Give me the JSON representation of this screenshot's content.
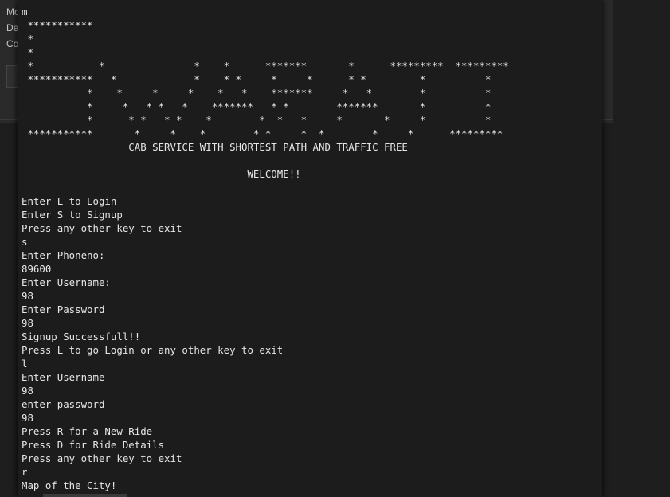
{
  "background_window": {
    "labels": [
      "Mo",
      "De",
      "Co"
    ]
  },
  "terminal": {
    "lines": [
      "m",
      " ***********",
      " *",
      " *",
      " *           *               *    *      *******       *      *********  *********",
      " ***********   *             *    * *     *     *      * *         *          *",
      "           *    *     *     *    *   *    *******     *   *        *          *",
      "           *     *   * *   *    *******   * *        *******       *          *",
      "           *      * *   * *    *        *  *   *     *       *     *          *",
      " ***********       *     *    *        * *     *  *        *     *      *********",
      "                  CAB SERVICE WITH SHORTEST PATH AND TRAFFIC FREE",
      "",
      "                                      WELCOME!!",
      "",
      "Enter L to Login",
      "Enter S to Signup",
      "Press any other key to exit",
      "s",
      "Enter Phoneno:",
      "89600",
      "Enter Username:",
      "98",
      "Enter Password",
      "98",
      "Signup Successfull!!",
      "Press L to go Login or any other key to exit",
      "l",
      "Enter Username",
      "98",
      "enter password",
      "98",
      "Press R for a New Ride",
      "Press D for Ride Details",
      "Press any other key to exit",
      "r",
      "Map of the City!"
    ]
  }
}
